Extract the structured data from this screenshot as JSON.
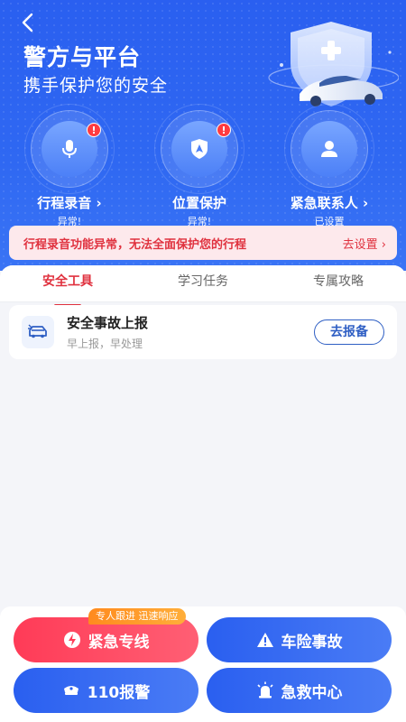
{
  "header": {
    "title": "警方与平台",
    "subtitle": "携手保护您的安全"
  },
  "features": [
    {
      "label": "行程录音 ›",
      "status": "异常!",
      "icon": "microphone-icon",
      "alert": "!"
    },
    {
      "label": "位置保护",
      "status": "异常!",
      "icon": "location-shield-icon",
      "alert": "!"
    },
    {
      "label": "紧急联系人 ›",
      "status": "已设置",
      "icon": "person-icon"
    }
  ],
  "alert": {
    "text": "行程录音功能异常，无法全面保护您的行程",
    "link": "去设置 ›"
  },
  "tabs": [
    "安全工具",
    "学习任务",
    "专属攻略"
  ],
  "active_tab": "安全工具",
  "card": {
    "title": "安全事故上报",
    "desc": "早上报，早处理",
    "button": "去报备",
    "icon": "car-accident-icon"
  },
  "bottom": {
    "bubble": "专人跟进 迅速响应",
    "buttons": [
      {
        "label": "紧急专线",
        "icon": "lightning-icon",
        "color": "#ff3b57"
      },
      {
        "label": "车险事故",
        "icon": "warning-icon",
        "color": "#2a5ff0"
      },
      {
        "label": "110报警",
        "icon": "police-cap-icon",
        "color": "#2a5ff0"
      },
      {
        "label": "急救中心",
        "icon": "siren-icon",
        "color": "#2a5ff0"
      }
    ]
  },
  "colors": {
    "primary": "#2a5ff0",
    "danger": "#e0323f",
    "alert_bg": "#fde9ec"
  }
}
